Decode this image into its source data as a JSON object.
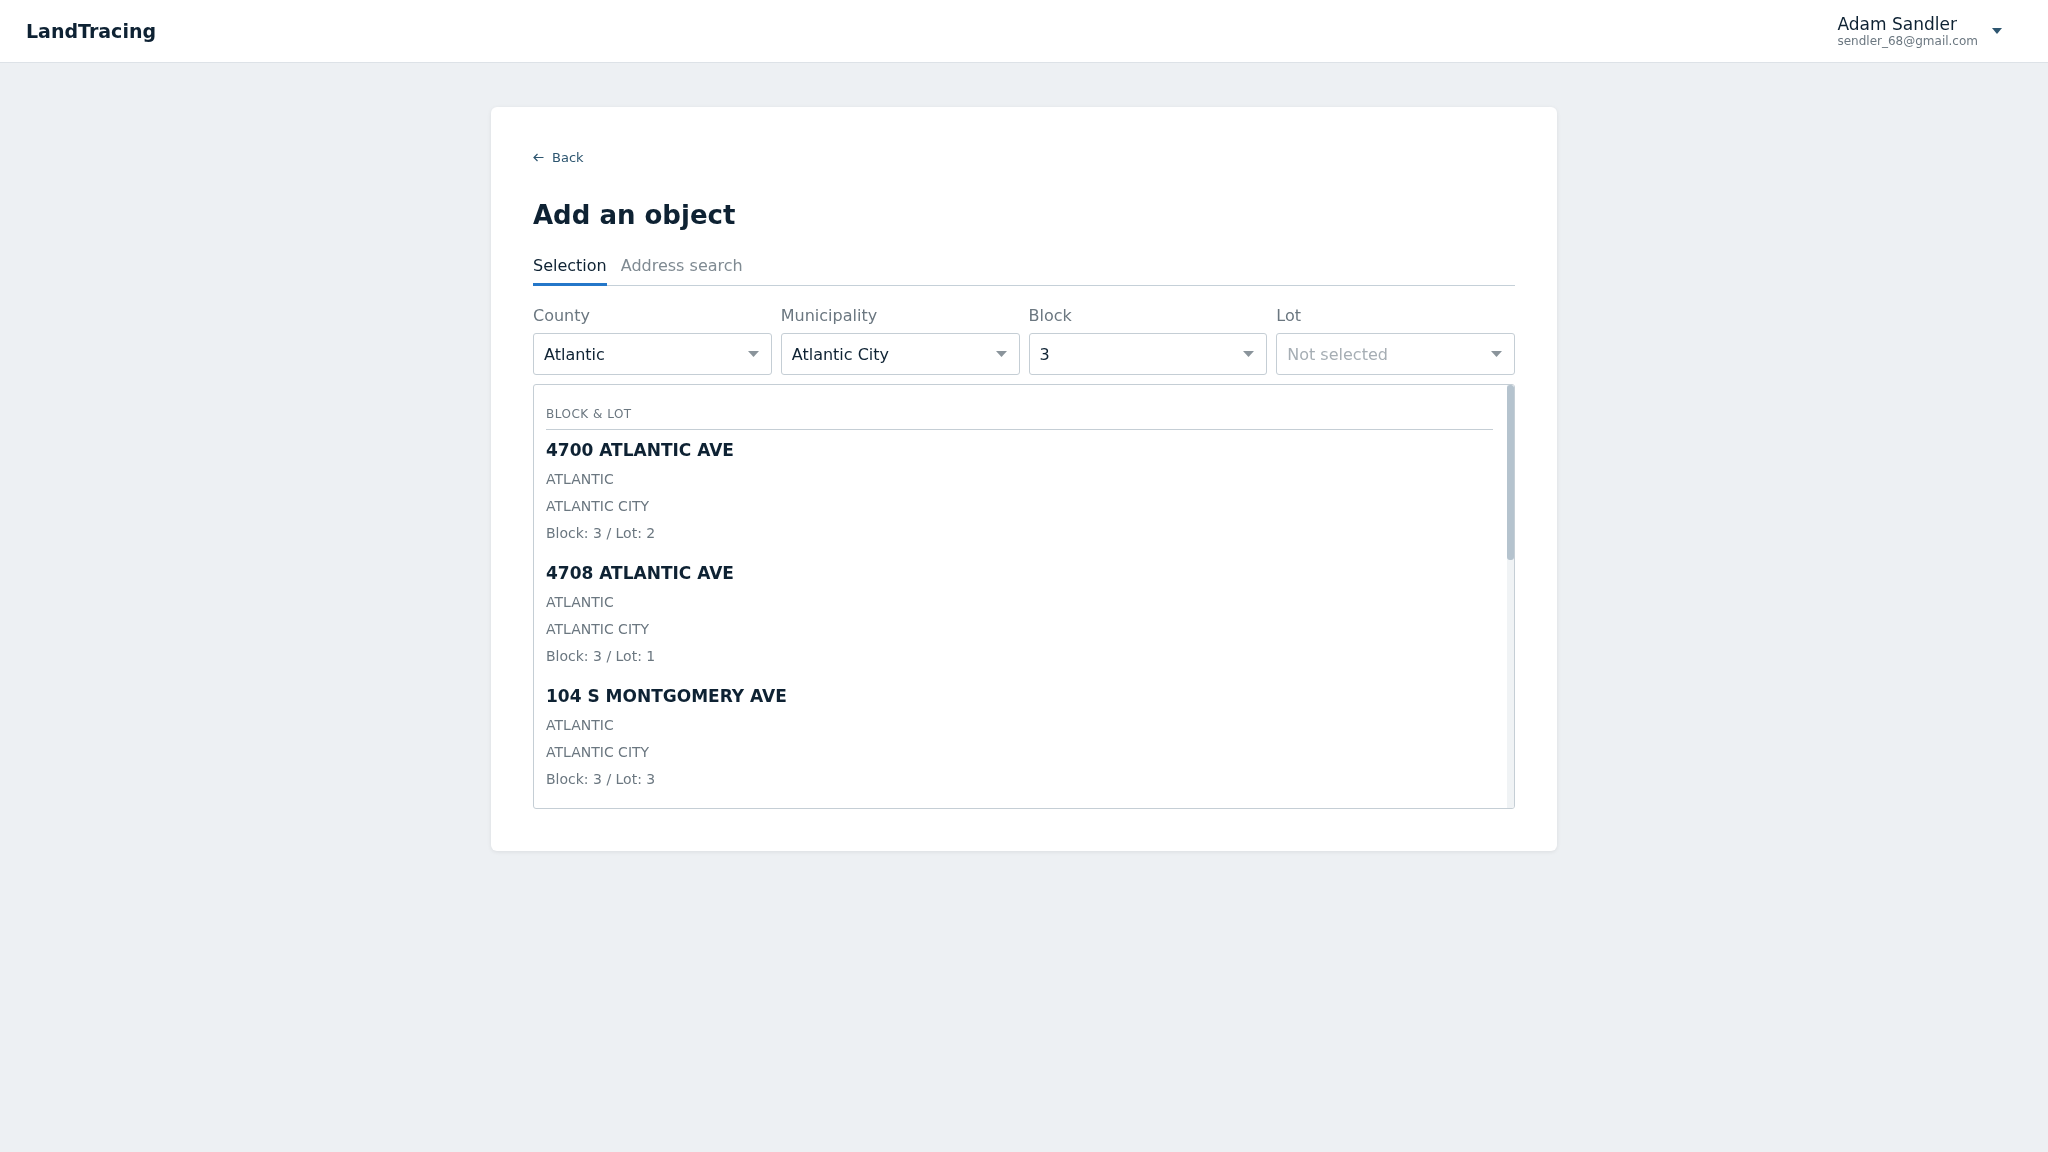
{
  "header": {
    "logo": "LandTracing",
    "user": {
      "name": "Adam Sandler",
      "email": "sendler_68@gmail.com"
    }
  },
  "card": {
    "back": "Back",
    "title": "Add an object",
    "tabs": [
      {
        "label": "Selection",
        "selected": true
      },
      {
        "label": "Address search",
        "selected": false
      }
    ],
    "fields": [
      {
        "label": "County",
        "value": "Atlantic"
      },
      {
        "label": "Municipality",
        "value": "Atlantic City"
      },
      {
        "label": "Block",
        "value": "3"
      },
      {
        "label": "Lot",
        "placeholder": "Not selected"
      }
    ],
    "results": {
      "heading": "BLOCK & LOT",
      "items": [
        {
          "address": "4700 ATLANTIC AVE",
          "county": "ATLANTIC",
          "city": "ATLANTIC CITY",
          "block_lot": "Block: 3 / Lot: 2"
        },
        {
          "address": "4708 ATLANTIC AVE",
          "county": "ATLANTIC",
          "city": "ATLANTIC CITY",
          "block_lot": "Block: 3 / Lot: 1"
        },
        {
          "address": "104 S MONTGOMERY AVE",
          "county": "ATLANTIC",
          "city": "ATLANTIC CITY",
          "block_lot": "Block: 3 / Lot: 3"
        }
      ]
    }
  }
}
